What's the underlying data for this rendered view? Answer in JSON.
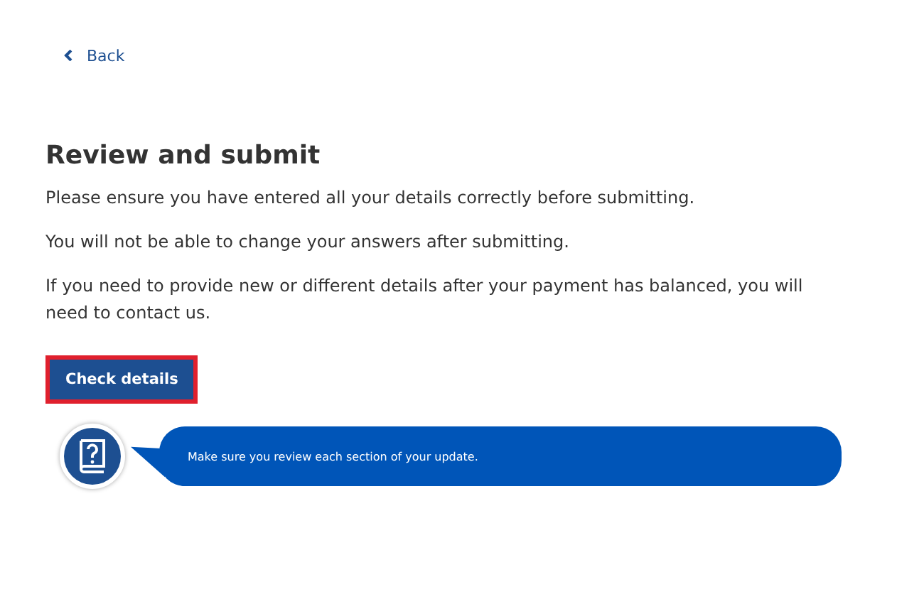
{
  "back_link": {
    "label": "Back"
  },
  "heading": "Review and submit",
  "paragraphs": [
    "Please ensure you have entered all your details correctly before submitting.",
    "You will not be able to change your answers after submitting.",
    "If you need to provide new or different details after your payment has balanced, you will need to contact us."
  ],
  "button": {
    "label": "Check details",
    "highlighted": true
  },
  "help_tip": {
    "text": "Make sure you review each section of your update."
  }
}
